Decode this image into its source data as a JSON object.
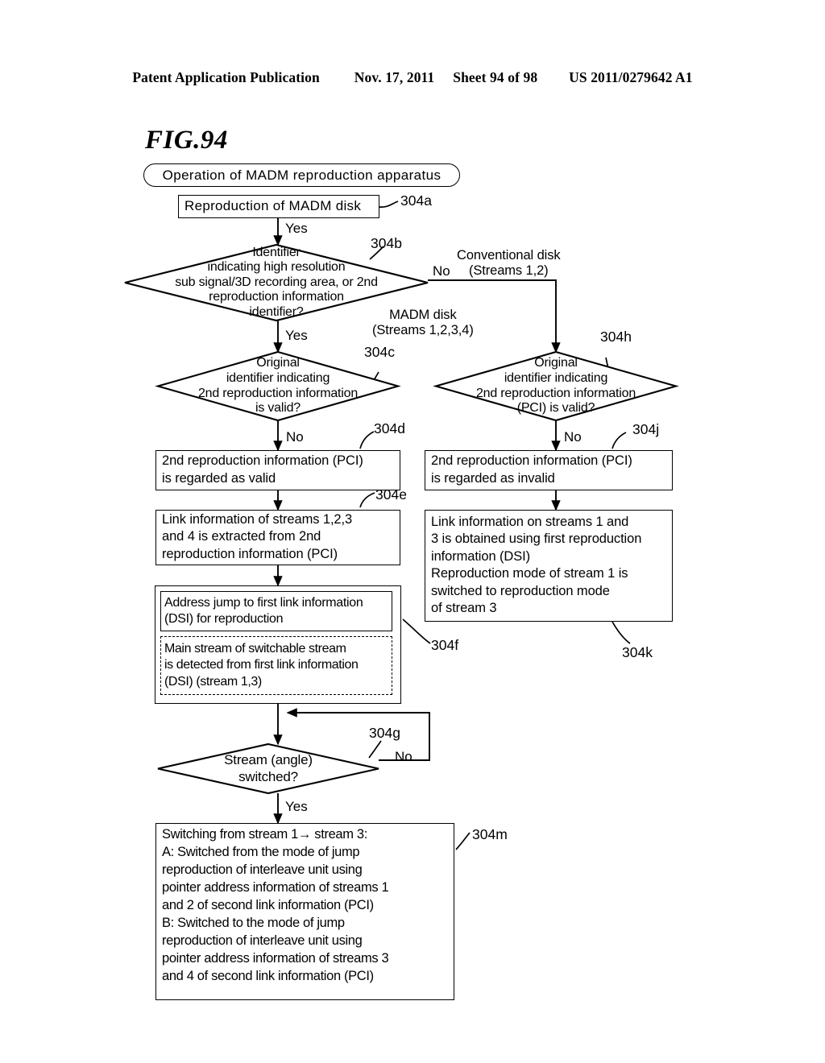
{
  "header": {
    "publication": "Patent Application Publication",
    "date": "Nov. 17, 2011",
    "sheet": "Sheet 94 of 98",
    "patent_number": "US 2011/0279642 A1"
  },
  "figure": {
    "label": "FIG.94",
    "title": "Operation of MADM reproduction apparatus"
  },
  "nodes": {
    "start": {
      "id": "304a",
      "text": "Reproduction of MADM disk"
    },
    "decision_b": {
      "id": "304b",
      "text": "Identifier\nindicating high resolution\nsub signal/3D recording area, or 2nd\nreproduction information\nidentifier?",
      "yes_in": "Yes",
      "yes_out": "Yes",
      "no_out": "No"
    },
    "decision_c": {
      "id": "304c",
      "text": "Original\nidentifier indicating\n2nd reproduction information\nis valid?",
      "no_out": "No"
    },
    "proc_d": {
      "id": "304d",
      "text": "2nd reproduction information (PCI)\nis regarded as valid"
    },
    "proc_e": {
      "id": "304e",
      "text": "Link information of streams 1,2,3\nand 4 is extracted from 2nd\nreproduction information (PCI)"
    },
    "proc_f_outer": {
      "id": "304f",
      "inner_solid": "Address jump to first link information\n(DSI) for reproduction",
      "inner_dashed": "Main stream of switchable stream\nis detected from first link information\n(DSI) (stream 1,3)"
    },
    "decision_h": {
      "id": "304h",
      "text": "Original\nidentifier indicating\n2nd reproduction information\n(PCI) is valid?",
      "no_out": "No"
    },
    "proc_j": {
      "id": "304j",
      "text": "2nd reproduction information (PCI)\nis regarded as invalid"
    },
    "proc_k": {
      "id": "304k",
      "text": "Link information on streams 1 and\n3 is obtained using first reproduction\ninformation (DSI)\nReproduction mode of stream 1 is\nswitched to reproduction mode\nof stream 3"
    },
    "decision_g": {
      "id": "304g",
      "text": "Stream (angle)\nswitched?",
      "no_out": "No",
      "yes_out": "Yes"
    },
    "proc_m": {
      "id": "304m",
      "text": "Switching from stream 1→ stream 3:\nA: Switched from the mode of jump\nreproduction of interleave unit using\npointer address information of streams 1\nand 2 of second link information (PCI)\nB: Switched to the mode of jump\nreproduction of interleave unit using\npointer address information of streams 3\nand 4 of second link information (PCI)"
    }
  },
  "edge_labels": {
    "conventional_disk": "Conventional disk\n(Streams 1,2)",
    "madm_disk": "MADM disk\n(Streams 1,2,3,4)"
  },
  "colors": {
    "ink": "#000000",
    "paper": "#ffffff"
  }
}
